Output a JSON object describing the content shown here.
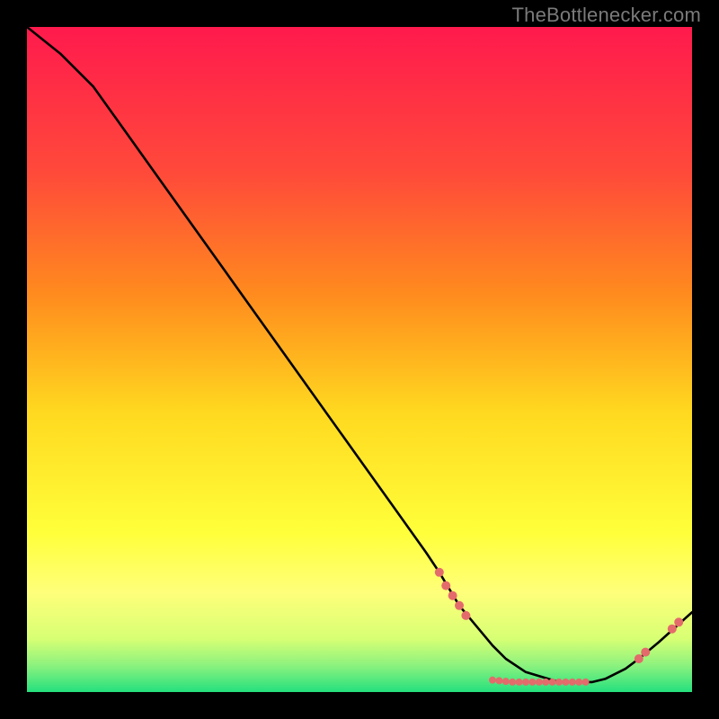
{
  "watermark": "TheBottlenecker.com",
  "colors": {
    "bg": "#000000",
    "gradient_top": "#ff1a4d",
    "gradient_mid_top": "#ff8a1e",
    "gradient_mid": "#ffd91f",
    "gradient_low": "#ffff7a",
    "gradient_bottom": "#24e07e",
    "curve": "#000000",
    "marker": "#e46b6b",
    "watermark": "#7a7a7a"
  },
  "chart_data": {
    "type": "line",
    "title": "",
    "xlabel": "",
    "ylabel": "",
    "xlim": [
      0,
      100
    ],
    "ylim": [
      0,
      100
    ],
    "series": [
      {
        "name": "curve",
        "x": [
          0,
          5,
          10,
          15,
          20,
          25,
          30,
          35,
          40,
          45,
          50,
          55,
          60,
          62,
          65,
          70,
          72,
          75,
          80,
          85,
          87,
          90,
          92,
          95,
          100
        ],
        "y": [
          100,
          96,
          91,
          84,
          77,
          70,
          63,
          56,
          49,
          42,
          35,
          28,
          21,
          18,
          13,
          7,
          5,
          3,
          1.5,
          1.5,
          2,
          3.5,
          5,
          7.5,
          12
        ]
      }
    ],
    "markers": [
      {
        "x": 62,
        "y": 18,
        "r": 5
      },
      {
        "x": 63,
        "y": 16,
        "r": 5
      },
      {
        "x": 64,
        "y": 14.5,
        "r": 5
      },
      {
        "x": 65,
        "y": 13,
        "r": 5
      },
      {
        "x": 66,
        "y": 11.5,
        "r": 5
      },
      {
        "x": 70,
        "y": 1.8,
        "r": 4
      },
      {
        "x": 71,
        "y": 1.7,
        "r": 4
      },
      {
        "x": 72,
        "y": 1.6,
        "r": 4
      },
      {
        "x": 73,
        "y": 1.5,
        "r": 4
      },
      {
        "x": 74,
        "y": 1.5,
        "r": 4
      },
      {
        "x": 75,
        "y": 1.5,
        "r": 4
      },
      {
        "x": 76,
        "y": 1.5,
        "r": 4
      },
      {
        "x": 77,
        "y": 1.5,
        "r": 4
      },
      {
        "x": 78,
        "y": 1.5,
        "r": 4
      },
      {
        "x": 79,
        "y": 1.5,
        "r": 4
      },
      {
        "x": 80,
        "y": 1.5,
        "r": 4
      },
      {
        "x": 81,
        "y": 1.5,
        "r": 4
      },
      {
        "x": 82,
        "y": 1.5,
        "r": 4
      },
      {
        "x": 83,
        "y": 1.5,
        "r": 4
      },
      {
        "x": 84,
        "y": 1.5,
        "r": 4
      },
      {
        "x": 92,
        "y": 5,
        "r": 5
      },
      {
        "x": 93,
        "y": 6,
        "r": 5
      },
      {
        "x": 97,
        "y": 9.5,
        "r": 5
      },
      {
        "x": 98,
        "y": 10.5,
        "r": 5
      }
    ]
  }
}
